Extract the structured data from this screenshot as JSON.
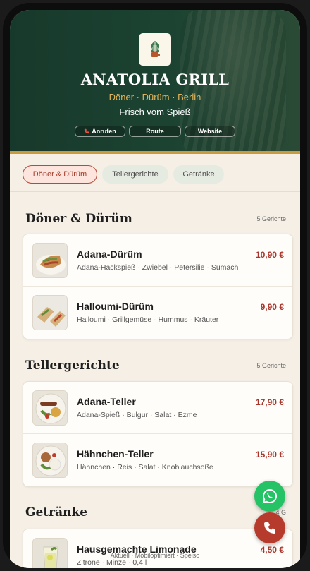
{
  "header": {
    "title": "ANATOLIA GRILL",
    "subtitle": "Döner · Dürüm · Berlin",
    "tagline": "Frisch vom Spieß",
    "actions": {
      "call": "Anrufen",
      "route": "Route",
      "website": "Website"
    }
  },
  "tabs": [
    {
      "label": "Döner & Dürüm",
      "active": true
    },
    {
      "label": "Tellergerichte",
      "active": false
    },
    {
      "label": "Getränke",
      "active": false
    }
  ],
  "sections": [
    {
      "title": "Döner & Dürüm",
      "count": "5 Gerichte",
      "items": [
        {
          "name": "Adana-Dürüm",
          "desc": "Adana-Hackspieß · Zwiebel · Petersilie · Sumach",
          "price": "10,90 €"
        },
        {
          "name": "Halloumi-Dürüm",
          "desc": "Halloumi · Grillgemüse · Hummus · Kräuter",
          "price": "9,90 €"
        }
      ]
    },
    {
      "title": "Tellergerichte",
      "count": "5 Gerichte",
      "items": [
        {
          "name": "Adana-Teller",
          "desc": "Adana-Spieß · Bulgur · Salat · Ezme",
          "price": "17,90 €"
        },
        {
          "name": "Hähnchen-Teller",
          "desc": "Hähnchen · Reis · Salat · Knoblauchsoße",
          "price": "15,90 €"
        }
      ]
    },
    {
      "title": "Getränke",
      "count": "4 G",
      "items": [
        {
          "name": "Hausgemachte Limonade",
          "desc": "Zitrone · Minze · 0,4 l",
          "price": "4,50 €"
        }
      ]
    }
  ],
  "footer": {
    "note": "Aktuell · Mobiloptimiert · Speiso"
  },
  "colors": {
    "hero": "#1c4332",
    "accent": "#c99a3e",
    "price": "#a8352b",
    "whatsapp": "#25c366",
    "call": "#b73b2c"
  },
  "icons": {
    "logo": "doner-spit-icon",
    "call": "phone-icon",
    "whatsapp": "whatsapp-icon",
    "phone_fab": "phone-icon"
  }
}
